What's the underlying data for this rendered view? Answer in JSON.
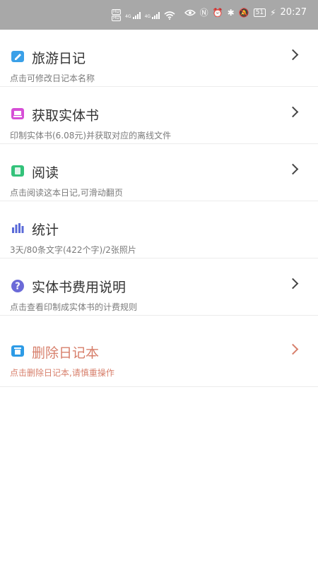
{
  "status": {
    "hd1": "HD",
    "hd2": "HD",
    "net1": "4G",
    "net2": "4G",
    "battery": "51",
    "time": "20:27"
  },
  "items": [
    {
      "title": "旅游日记",
      "subtitle": "点击可修改日记本名称",
      "icon": "edit-icon",
      "color": "#3aa0e8"
    },
    {
      "title": "获取实体书",
      "subtitle": "印制实体书(6.08元)并获取对应的离线文件",
      "icon": "book-print-icon",
      "color": "#d64fd6"
    },
    {
      "title": "阅读",
      "subtitle": "点击阅读这本日记,可滑动翻页",
      "icon": "read-icon",
      "color": "#33c27a"
    },
    {
      "title": "统计",
      "subtitle": "3天/80条文字(422个字)/2张照片",
      "icon": "bar-chart-icon",
      "color": "#5a6ad8"
    },
    {
      "title": "实体书费用说明",
      "subtitle": "点击查看印制成实体书的计费规则",
      "icon": "question-icon",
      "color": "#6b6ad8"
    },
    {
      "title": "删除日记本",
      "subtitle": "点击删除日记本,请慎重操作",
      "icon": "trash-icon",
      "color": "#2d9be6"
    }
  ]
}
